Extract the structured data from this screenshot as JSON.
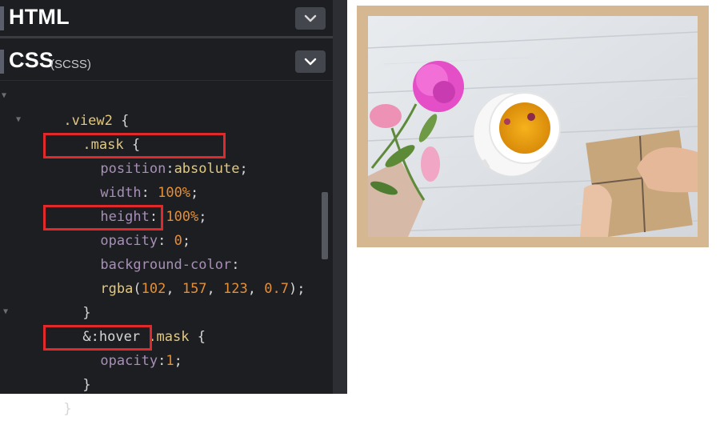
{
  "panels": {
    "html": {
      "title": "HTML"
    },
    "css": {
      "title": "CSS",
      "subtitle": "(SCSS)"
    }
  },
  "icons": {
    "collapse_html": "chevron-down-icon",
    "collapse_css": "chevron-down-icon",
    "fold": "fold-triangle-icon"
  },
  "code": {
    "l1_sel": ".view2",
    "l1_brace": " {",
    "l2_sel": ".mask",
    "l2_brace": " {",
    "l3_prop": "position",
    "l3_colon": ":",
    "l3_val": "absolute",
    "l3_end": ";",
    "l4_prop": "width",
    "l4_colon": ": ",
    "l4_val": "100%",
    "l4_end": ";",
    "l5_prop": "height",
    "l5_colon": ": ",
    "l5_val": "100%",
    "l5_end": ";",
    "l6_prop": "opacity",
    "l6_colon": ": ",
    "l6_val": "0",
    "l6_end": ";",
    "l7_prop": "background-color",
    "l7_colon": ":",
    "l8_fn": "rgba",
    "l8_open": "(",
    "l8_a": "102",
    "l8_c1": ", ",
    "l8_b": "157",
    "l8_c2": ", ",
    "l8_c": "123",
    "l8_c3": ", ",
    "l8_d": "0.7",
    "l8_close": ");",
    "l9": "}",
    "l10_pre": "&:hover ",
    "l10_sel": ".mask",
    "l10_brace": " {",
    "l11_prop": "opacity",
    "l11_colon": ":",
    "l11_val": "1",
    "l11_end": ";",
    "l12": "}",
    "l13": "}"
  },
  "colors": {
    "editor_bg": "#1d1e22",
    "highlight": "#e0292b",
    "frame": "#d5b892"
  }
}
